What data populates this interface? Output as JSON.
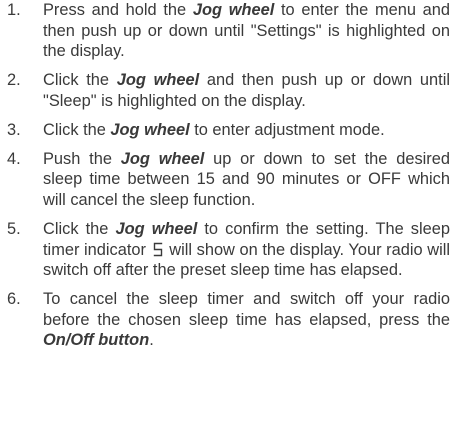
{
  "steps": [
    {
      "number": "1.",
      "pre": "Press and hold the ",
      "bold": "Jog wheel",
      "post": " to enter the menu and then push up or down until \"Settings\" is highlighted on the display."
    },
    {
      "number": "2.",
      "pre": "Click the ",
      "bold": "Jog wheel",
      "post": " and then push up or down until \"Sleep\" is highlighted on the display."
    },
    {
      "number": "3.",
      "pre": "Click the ",
      "bold": "Jog wheel",
      "post": " to enter adjustment mode."
    },
    {
      "number": "4.",
      "pre": "Push the ",
      "bold": "Jog wheel",
      "post": " up or down to set the desired sleep time between 15 and 90 minutes or OFF which will cancel the sleep function."
    },
    {
      "number": "5.",
      "pre": "Click the ",
      "bold": "Jog wheel",
      "mid": " to confirm the setting. The sleep timer indicator",
      "icon": "sleep-timer-indicator-icon",
      "post": "will show on the display. Your radio will switch off after the preset sleep time has elapsed."
    },
    {
      "number": "6.",
      "pre": "To cancel the sleep timer and switch off your radio before the chosen sleep time has elapsed, press the ",
      "bold": "On/Off button",
      "post": "."
    }
  ]
}
